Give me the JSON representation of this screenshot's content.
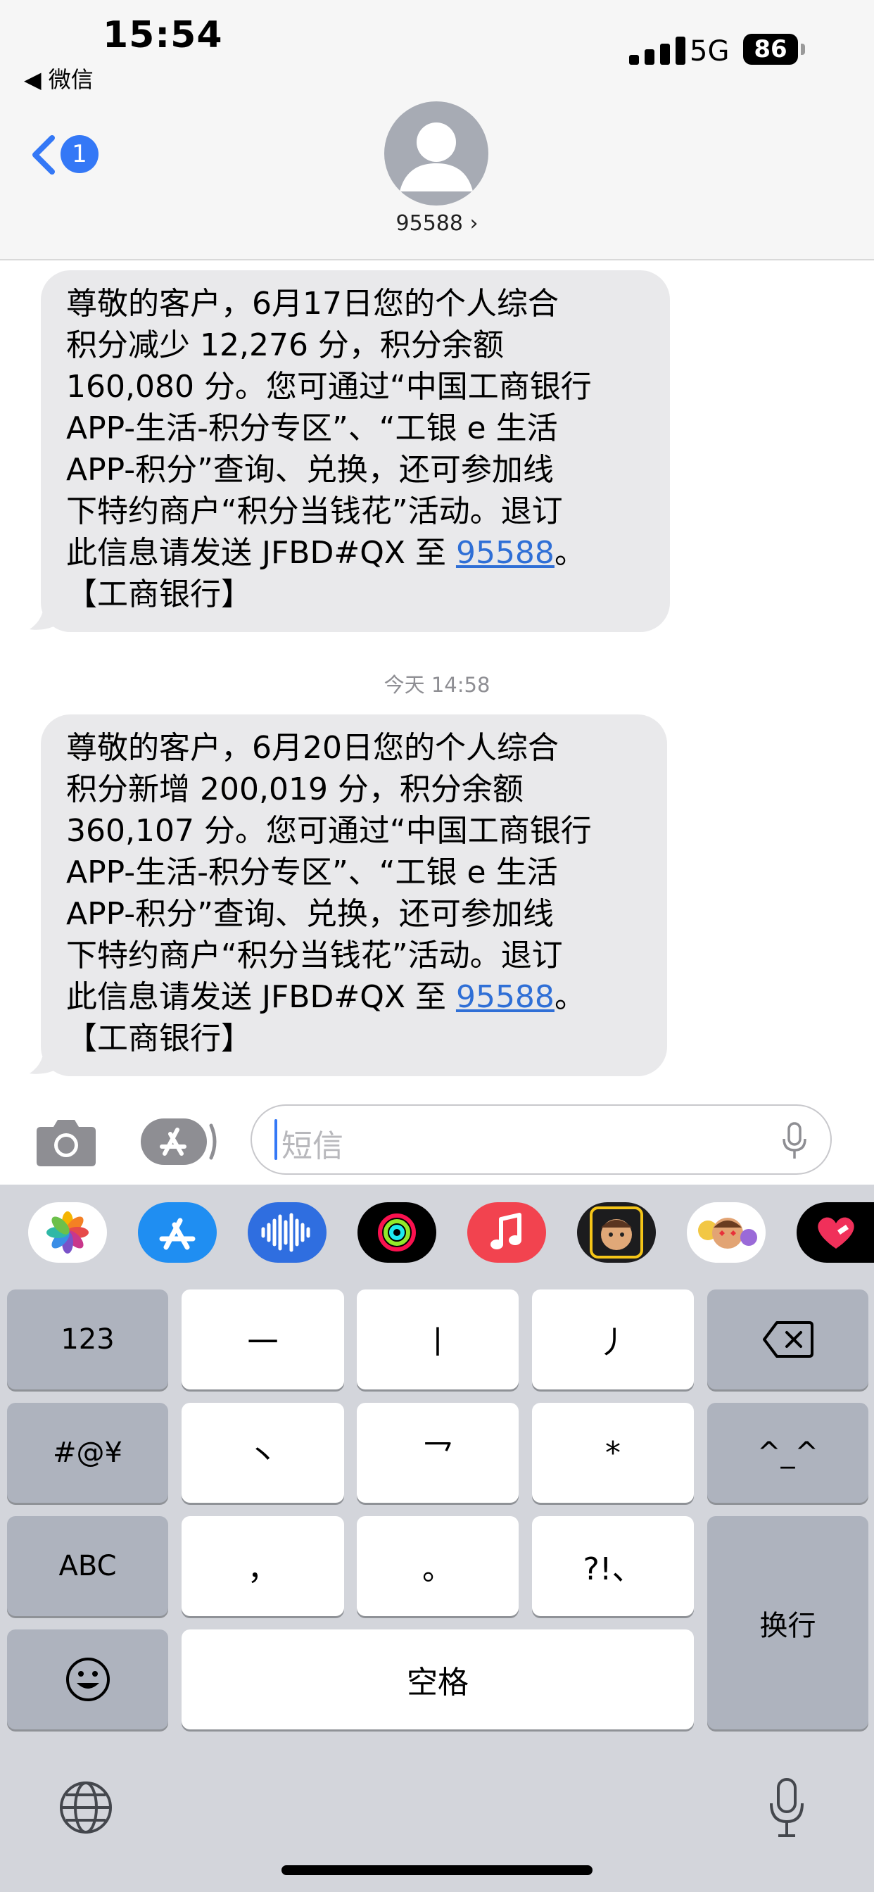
{
  "status_bar": {
    "time": "15:54",
    "back_app": "◀ 微信",
    "network": "5G",
    "battery": "86"
  },
  "header": {
    "back_badge": "1",
    "contact": "95588 ›"
  },
  "messages": [
    {
      "lines": [
        "尊敬的客户，6月17日您的个人综合",
        "积分减少 12,276 分，积分余额",
        "160,080 分。您可通过“中国工商银行",
        "APP-生活-积分专区”、“工银 e 生活",
        "APP-积分”查询、兑换，还可参加线",
        "下特约商户“积分当钱花”活动。退订"
      ],
      "last_prefix": "此信息请发送 JFBD#QX 至 ",
      "link": "95588",
      "last_suffix": "。",
      "sign": "【工商银行】"
    },
    {
      "lines": [
        "尊敬的客户，6月20日您的个人综合",
        "积分新增 200,019 分，积分余额",
        "360,107 分。您可通过“中国工商银行",
        "APP-生活-积分专区”、“工银 e 生活",
        "APP-积分”查询、兑换，还可参加线",
        "下特约商户“积分当钱花”活动。退订"
      ],
      "last_prefix": "此信息请发送 JFBD#QX 至 ",
      "link": "95588",
      "last_suffix": "。",
      "sign": "【工商银行】"
    }
  ],
  "timestamp": {
    "prefix": "今天",
    "time": "14:58"
  },
  "compose": {
    "placeholder": "短信"
  },
  "app_strip": [
    "photos-icon",
    "app-store-icon",
    "audio-message-icon",
    "fitness-icon",
    "music-icon",
    "memoji-icon",
    "memoji-stickers-icon",
    "digital-touch-icon"
  ],
  "keyboard": {
    "k_123": "123",
    "k_stroke1": "一",
    "k_stroke2": "丨",
    "k_stroke3": "丿",
    "k_symbols": "#@¥",
    "k_stroke4": "丶",
    "k_stroke5": "乛",
    "k_star": "*",
    "k_face": "^_^",
    "k_abc": "ABC",
    "k_comma": "，",
    "k_period": "。",
    "k_punct": "?!、",
    "k_return": "换行",
    "k_space": "空格"
  }
}
